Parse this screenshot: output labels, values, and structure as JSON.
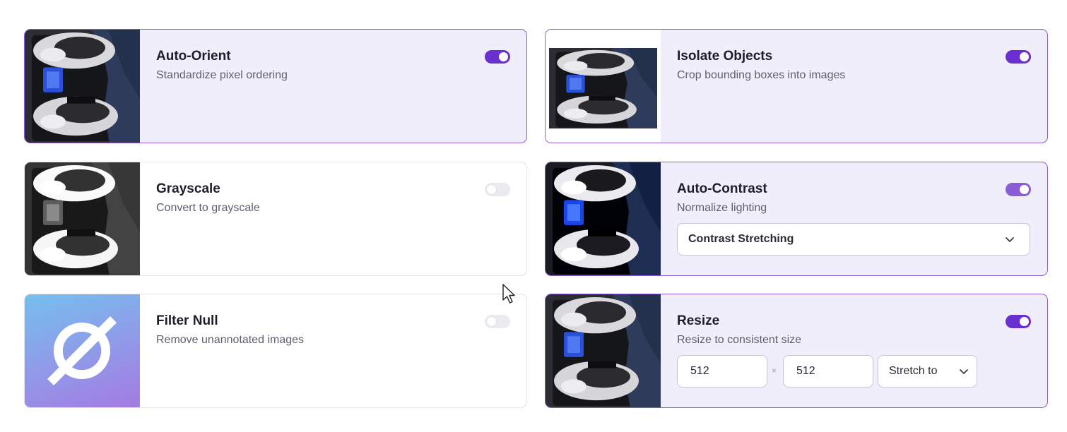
{
  "cards": {
    "auto_orient": {
      "title": "Auto-Orient",
      "description": "Standardize pixel ordering",
      "enabled": true
    },
    "isolate_objects": {
      "title": "Isolate Objects",
      "description": "Crop bounding boxes into images",
      "enabled": true
    },
    "grayscale": {
      "title": "Grayscale",
      "description": "Convert to grayscale",
      "enabled": false
    },
    "auto_contrast": {
      "title": "Auto-Contrast",
      "description": "Normalize lighting",
      "enabled": true,
      "selected_option": "Contrast Stretching"
    },
    "filter_null": {
      "title": "Filter Null",
      "description": "Remove unannotated images",
      "enabled": false
    },
    "resize": {
      "title": "Resize",
      "description": "Resize to consistent size",
      "enabled": true,
      "width": "512",
      "height": "512",
      "separator": "×",
      "mode": "Stretch to"
    }
  },
  "icons": {
    "toggle": "toggle-switch-icon",
    "dropdown": "chevron-down-icon",
    "null_symbol": "empty-set-icon",
    "cursor": "mouse-pointer-icon"
  },
  "colors": {
    "accent": "#6a2fd0",
    "active_card_bg": "#f1eefb",
    "active_card_border": "#8a5cd6"
  }
}
